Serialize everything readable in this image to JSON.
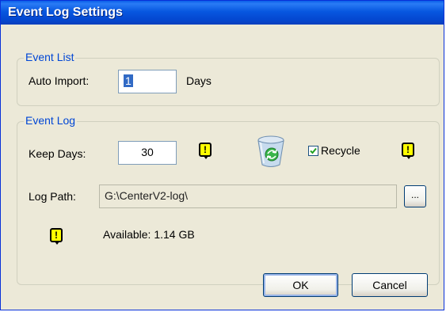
{
  "window": {
    "title": "Event Log Settings"
  },
  "event_list": {
    "group_label": "Event List",
    "auto_import_label": "Auto Import:",
    "auto_import_value": "1",
    "days_label": "Days"
  },
  "event_log": {
    "group_label": "Event Log",
    "keep_days_label": "Keep Days:",
    "keep_days_value": "30",
    "recycle_label": "Recycle",
    "recycle_checked": true,
    "log_path_label": "Log Path:",
    "log_path_value": "G:\\CenterV2-log\\",
    "browse_label": "...",
    "available_text": "Available: 1.14 GB",
    "warning_glyph": "!"
  },
  "buttons": {
    "ok_label": "OK",
    "cancel_label": "Cancel"
  },
  "icons": {
    "warning": "warning-icon",
    "recycle_bin": "recycle-bin-icon",
    "checkmark": "checkmark-icon"
  },
  "colors": {
    "title_bar": "#0757e0",
    "group_label": "#0046d5",
    "warning_fill": "#ffff00",
    "selection": "#316ac5"
  }
}
